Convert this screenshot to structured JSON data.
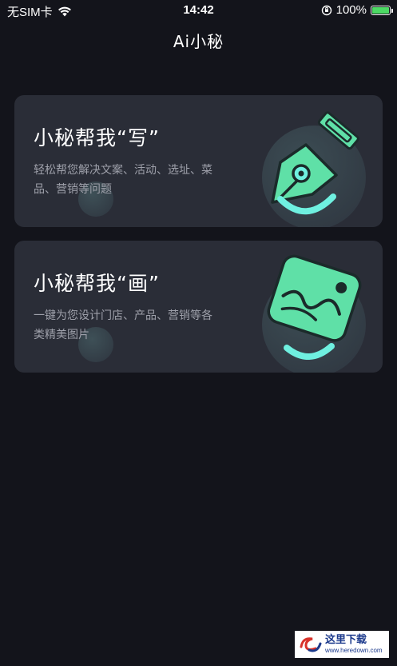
{
  "status_bar": {
    "carrier": "无SIM卡",
    "time": "14:42",
    "battery_percent": "100%"
  },
  "nav": {
    "title": "Ai小秘"
  },
  "cards": [
    {
      "title": "小秘帮我“写”",
      "description": "轻松帮您解决文案、活动、选址、菜品、营销等问题",
      "icon": "pen-nib-icon"
    },
    {
      "title": "小秘帮我“画”",
      "description": "一键为您设计门店、产品、营销等各类精美图片",
      "icon": "picture-icon"
    }
  ],
  "watermark": {
    "main": "这里下载",
    "url": "www.heredown.com"
  },
  "colors": {
    "background": "#13141b",
    "card": "#2a2d37",
    "accent_green": "#5fe0a7",
    "accent_cyan": "#6ff0e0"
  }
}
